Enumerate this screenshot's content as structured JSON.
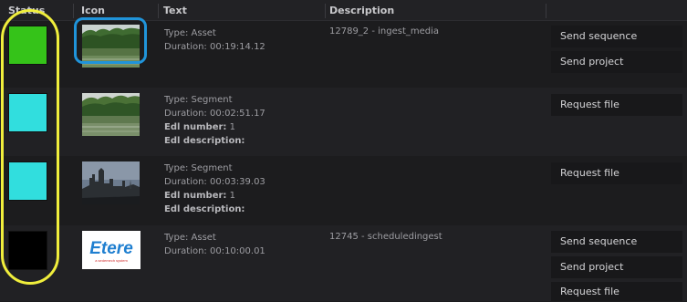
{
  "columns": {
    "status": "Status",
    "icon": "Icon",
    "text": "Text",
    "description": "Description"
  },
  "rows": [
    {
      "status_color": "#35c319",
      "thumbnail": "lake-landscape",
      "type": "Type: Asset",
      "duration": "Duration: 00:19:14.12",
      "description": "12789_2 - ingest_media",
      "actions": [
        "Send sequence",
        "Send project"
      ]
    },
    {
      "status_color": "#31dede",
      "thumbnail": "lake-landscape",
      "type": "Type: Segment",
      "duration": "Duration: 00:02:51.17",
      "edl_number_label": "Edl number:",
      "edl_number_value": " 1",
      "edl_description_label": "Edl description:",
      "description": "",
      "actions": [
        "Request file"
      ]
    },
    {
      "status_color": "#31dede",
      "thumbnail": "dusk-castle",
      "type": "Type: Segment",
      "duration": "Duration: 00:03:39.03",
      "edl_number_label": "Edl number:",
      "edl_number_value": " 1",
      "edl_description_label": "Edl description:",
      "description": "",
      "actions": [
        "Request file"
      ]
    },
    {
      "status_color": "#000000",
      "thumbnail": "etere-logo",
      "logo_text": "Etere",
      "logo_tagline": "a sedemech system",
      "type": "Type: Asset",
      "duration": "Duration: 00:10:00.01",
      "description": "12745 - scheduledingest",
      "actions": [
        "Send sequence",
        "Send project",
        "Request file"
      ]
    }
  ],
  "annotations": {
    "blue_highlight_color": "#2094da",
    "yellow_highlight_color": "#f0ee3c"
  }
}
